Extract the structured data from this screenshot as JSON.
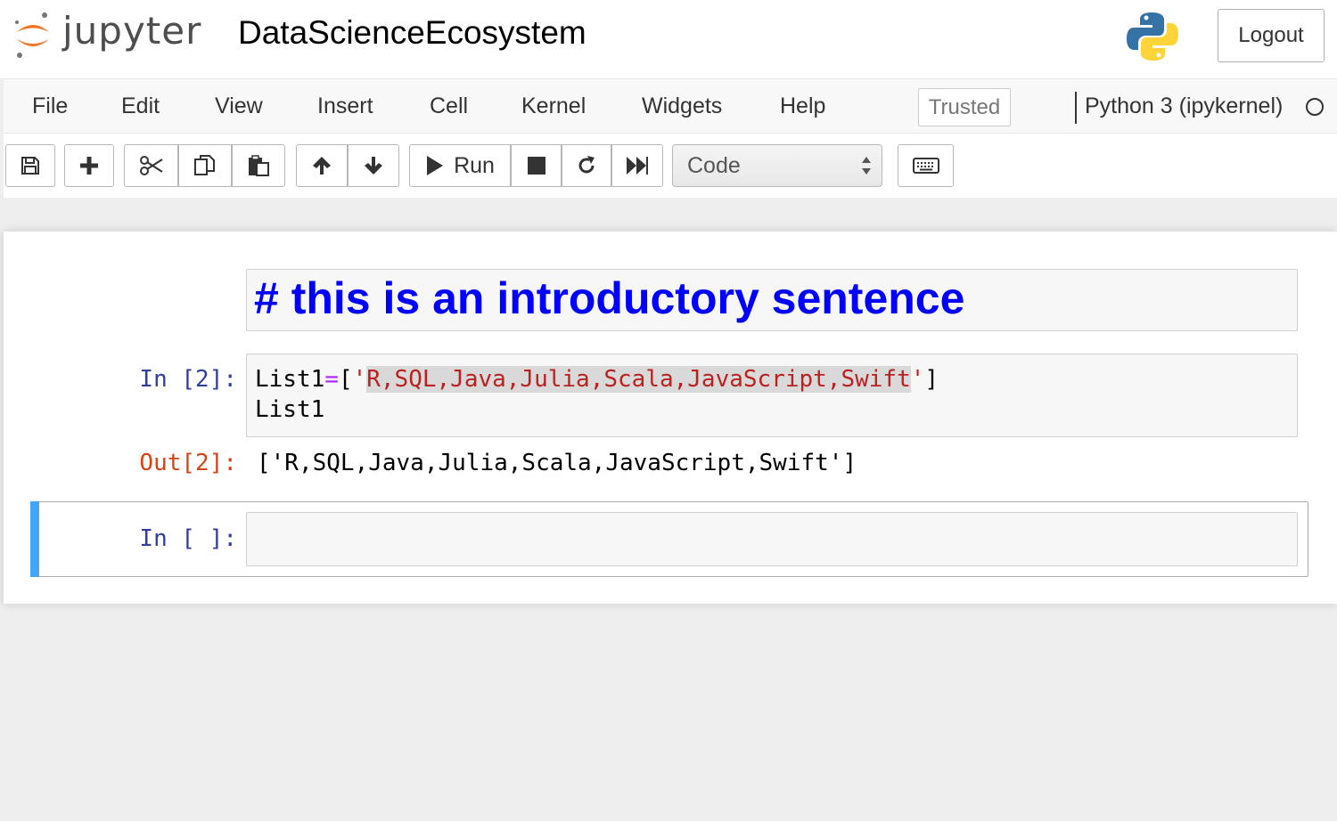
{
  "header": {
    "logo_text": "jupyter",
    "notebook_title": "DataScienceEcosystem",
    "logout_label": "Logout",
    "icons": {
      "jupyter": "jupyter-logo-icon",
      "python": "python-logo-icon"
    }
  },
  "menubar": {
    "items": [
      {
        "label": "File"
      },
      {
        "label": "Edit"
      },
      {
        "label": "View"
      },
      {
        "label": "Insert"
      },
      {
        "label": "Cell"
      },
      {
        "label": "Kernel"
      },
      {
        "label": "Widgets"
      },
      {
        "label": "Help"
      }
    ],
    "trusted_label": "Trusted",
    "kernel_name": "Python 3 (ipykernel)",
    "kernel_status_icon": "kernel-idle-circle-icon"
  },
  "toolbar": {
    "run_label": "Run",
    "cell_type": "Code",
    "icons": [
      "save-icon",
      "plus-icon",
      "cut-icon",
      "copy-icon",
      "paste-icon",
      "arrow-up-icon",
      "arrow-down-icon",
      "play-icon",
      "stop-icon",
      "restart-icon",
      "fast-forward-icon",
      "keyboard-icon"
    ]
  },
  "cells": {
    "markdown": {
      "text": "# this is an introductory sentence"
    },
    "code1": {
      "prompt_in": "In [2]:",
      "line1": {
        "name": "List1",
        "op": "=",
        "open": "[",
        "q1": "'",
        "str": "R,SQL,Java,Julia,Scala,JavaScript,Swift",
        "q2": "'",
        "close": "]"
      },
      "line2": "List1",
      "prompt_out": "Out[2]:",
      "output": "['R,SQL,Java,Julia,Scala,JavaScript,Swift']"
    },
    "code2": {
      "prompt_in": "In [ ]:"
    }
  },
  "colors": {
    "markdown_heading": "#0000ff",
    "prompt_in": "#303f9f",
    "prompt_out": "#d84315",
    "string": "#ba2121",
    "operator": "#aa22ff",
    "selected_cell_bar": "#42a5f5"
  }
}
